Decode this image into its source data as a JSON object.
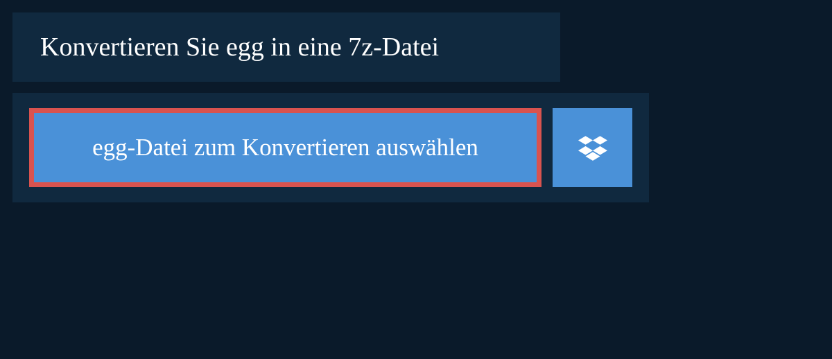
{
  "header": {
    "title": "Konvertieren Sie egg in eine 7z-Datei"
  },
  "upload": {
    "select_file_label": "egg-Datei zum Konvertieren auswählen"
  }
}
